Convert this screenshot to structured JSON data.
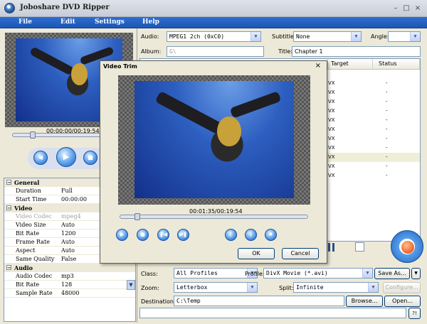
{
  "window": {
    "title": "Joboshare DVD Ripper",
    "minimize": "–",
    "maximize": "□",
    "close": "×"
  },
  "menu": [
    "File",
    "Edit",
    "Settings",
    "Help"
  ],
  "preview": {
    "timecode": "00:00:00/00:19:54",
    "progress": 0.16
  },
  "properties": [
    {
      "group": true,
      "key": "General"
    },
    {
      "key": "Duration",
      "value": "Full"
    },
    {
      "key": "Start Time",
      "value": "00:00:00"
    },
    {
      "group": true,
      "key": "Video"
    },
    {
      "key": "Video Codec",
      "value": "mpeg4",
      "disabled": true
    },
    {
      "key": "Video Size",
      "value": "Auto"
    },
    {
      "key": "Bit Rate",
      "value": "1200"
    },
    {
      "key": "Frame Rate",
      "value": "Auto"
    },
    {
      "key": "Aspect",
      "value": "Auto"
    },
    {
      "key": "Same Quality",
      "value": "False"
    },
    {
      "group": true,
      "key": "Audio"
    },
    {
      "key": "Audio Codec",
      "value": "mp3"
    },
    {
      "key": "Bit Rate",
      "value": "128"
    },
    {
      "key": "Sample Rate",
      "value": "48000"
    }
  ],
  "top": {
    "audio_label": "Audio:",
    "audio_value": "MPEG1 2ch (0xC0)",
    "subtitle_label": "Subtitle:",
    "subtitle_value": "None",
    "angle_label": "Angle:",
    "angle_value": "",
    "album_label": "Album:",
    "album_value": "G\\",
    "title_label": "Title:",
    "title_value": "Chapter 1"
  },
  "table": {
    "columns": [
      "Target",
      "Status"
    ],
    "rows": [
      {
        "target": "VX",
        "status": "-"
      },
      {
        "target": "VX",
        "status": "-"
      },
      {
        "target": "VX",
        "status": "-"
      },
      {
        "target": "VX",
        "status": "-"
      },
      {
        "target": "VX",
        "status": "-"
      },
      {
        "target": "VX",
        "status": "-"
      },
      {
        "target": "VX",
        "status": "-"
      },
      {
        "target": "VX",
        "status": "-"
      },
      {
        "target": "VX",
        "status": "-",
        "selected": true
      },
      {
        "target": "VX",
        "status": "-"
      },
      {
        "target": "VX",
        "status": "-"
      }
    ]
  },
  "bottom": {
    "class_label": "Class:",
    "class_value": "All Profiles",
    "profile_label": "Profile:",
    "profile_value": "DivX Movie  (*.avi)",
    "save_as": "Save As...",
    "zoom_label": "Zoom:",
    "zoom_value": "Letterbox",
    "split_label": "Split:",
    "split_value": "Infinite",
    "configure": "Configure...",
    "destination_label": "Destination:",
    "destination_value": "C:\\Temp",
    "browse": "Browse...",
    "open": "Open...",
    "help_btn": "?!"
  },
  "dialog": {
    "title": "Video Trim",
    "close": "×",
    "timecode": "00:01:35/00:19:54",
    "progress": 0.08,
    "ok": "OK",
    "cancel": "Cancel"
  }
}
